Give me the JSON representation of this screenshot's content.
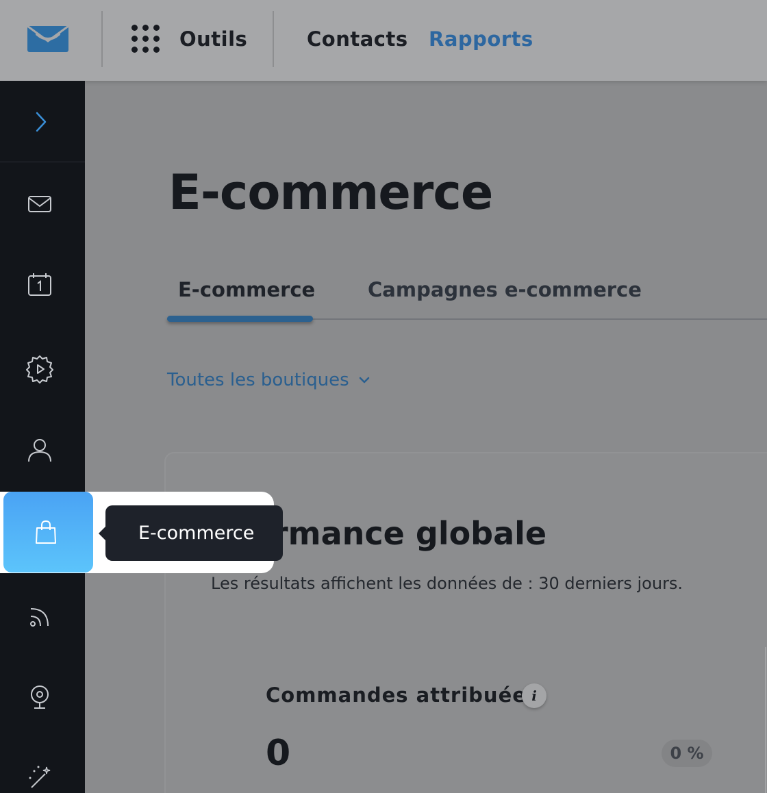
{
  "topbar": {
    "tools_label": "Outils",
    "contacts_label": "Contacts",
    "reports_label": "Rapports"
  },
  "sidebar": {
    "items": [
      {
        "icon": "email-icon"
      },
      {
        "icon": "calendar-icon"
      },
      {
        "icon": "automation-icon"
      },
      {
        "icon": "contact-icon"
      },
      {
        "icon": "shopping-bag-icon",
        "active": true
      },
      {
        "icon": "rss-icon"
      },
      {
        "icon": "webinar-icon"
      },
      {
        "icon": "magic-wand-icon"
      }
    ]
  },
  "tooltip": {
    "text": "E-commerce"
  },
  "main": {
    "title": "E-commerce",
    "tabs": [
      {
        "label": "E-commerce",
        "active": true
      },
      {
        "label": "Campagnes e-commerce",
        "active": false
      }
    ],
    "shop_filter": "Toutes les boutiques",
    "card": {
      "title_visible": "rmance globale",
      "subtitle": "Les résultats affichent les données de : 30 derniers jours.",
      "metric_label": "Commandes attribuées",
      "info_icon_text": "i",
      "metric_value": "0",
      "metric_change": "0 %"
    }
  },
  "colors": {
    "accent": "#2d67a0",
    "sidebar_bg": "#12151a",
    "highlight_start": "#4aa3f4",
    "highlight_end": "#5cc4fb",
    "tooltip_bg": "#1e222a"
  }
}
